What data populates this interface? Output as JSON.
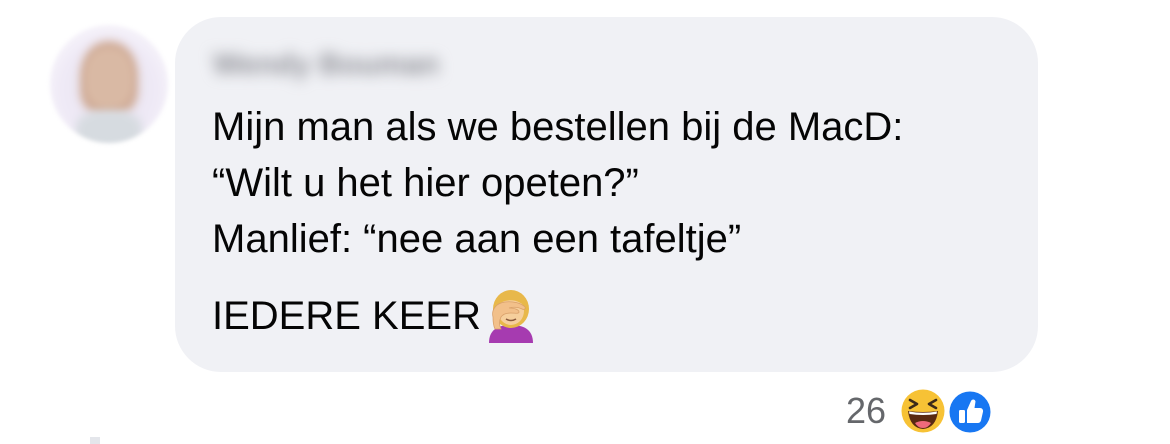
{
  "comment": {
    "author_name": "Wendy Bouman",
    "lines": [
      "Mijn man als we bestellen bij de MacD:",
      "“Wilt u het hier opeten?”",
      "Manlief: “nee aan een tafeltje”"
    ],
    "last_line": "IEDERE KEER",
    "last_line_emoji": "woman-facepalming-icon",
    "reactions": {
      "count": "26",
      "icons": [
        "haha-icon",
        "like-icon"
      ]
    }
  },
  "colors": {
    "bubble_background": "#f0f1f5",
    "text": "#050505",
    "secondary_text": "#65676b",
    "like_blue": "#1877f2",
    "haha_yellow": "#f7c235"
  }
}
